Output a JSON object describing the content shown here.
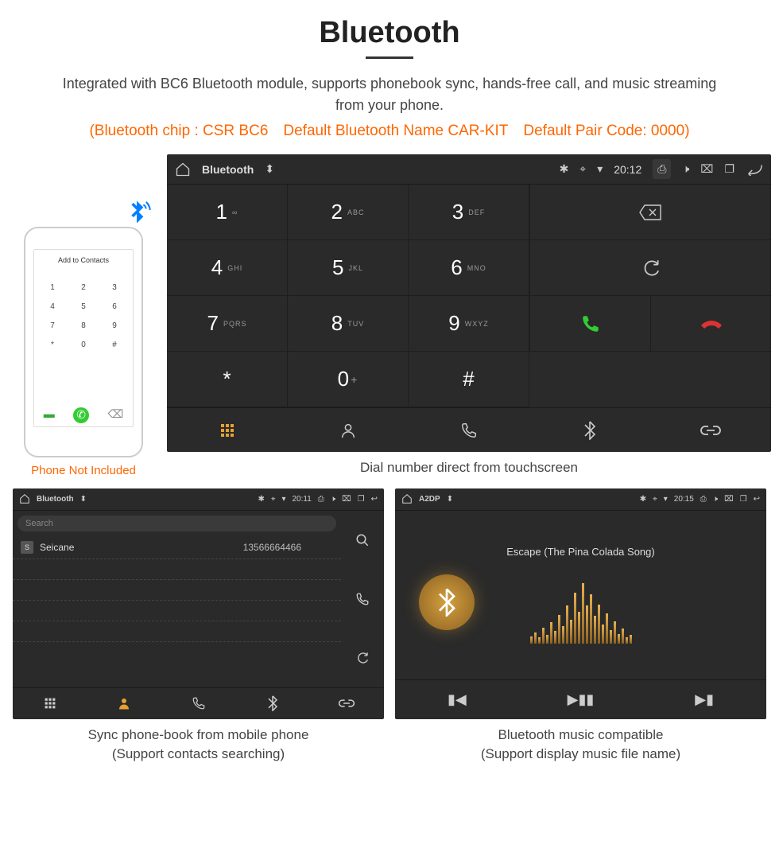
{
  "title": "Bluetooth",
  "subtitle": "Integrated with BC6 Bluetooth module, supports phonebook sync, hands-free call, and music streaming from your phone.",
  "warn": "(Bluetooth chip : CSR BC6 Default Bluetooth Name CAR-KIT Default Pair Code: 0000)",
  "phone_caption": "Phone Not Included",
  "phone_mock": {
    "header": "Add to Contacts"
  },
  "dialer": {
    "app_title": "Bluetooth",
    "time": "20:12",
    "keys": [
      {
        "n": "1",
        "l": "∞"
      },
      {
        "n": "2",
        "l": "ABC"
      },
      {
        "n": "3",
        "l": "DEF"
      },
      {
        "n": "4",
        "l": "GHI"
      },
      {
        "n": "5",
        "l": "JKL"
      },
      {
        "n": "6",
        "l": "MNO"
      },
      {
        "n": "7",
        "l": "PQRS"
      },
      {
        "n": "8",
        "l": "TUV"
      },
      {
        "n": "9",
        "l": "WXYZ"
      },
      {
        "n": "*",
        "l": ""
      },
      {
        "n": "0",
        "l": "+"
      },
      {
        "n": "#",
        "l": ""
      }
    ],
    "caption": "Dial number direct from touchscreen"
  },
  "phonebook": {
    "app_title": "Bluetooth",
    "time": "20:11",
    "search_placeholder": "Search",
    "contact": {
      "letter": "S",
      "name": "Seicane",
      "number": "13566664466"
    },
    "caption_l1": "Sync phone-book from mobile phone",
    "caption_l2": "(Support contacts searching)"
  },
  "music": {
    "app_title": "A2DP",
    "time": "20:15",
    "track": "Escape (The Pina Colada Song)",
    "caption_l1": "Bluetooth music compatible",
    "caption_l2": "(Support display music file name)"
  }
}
